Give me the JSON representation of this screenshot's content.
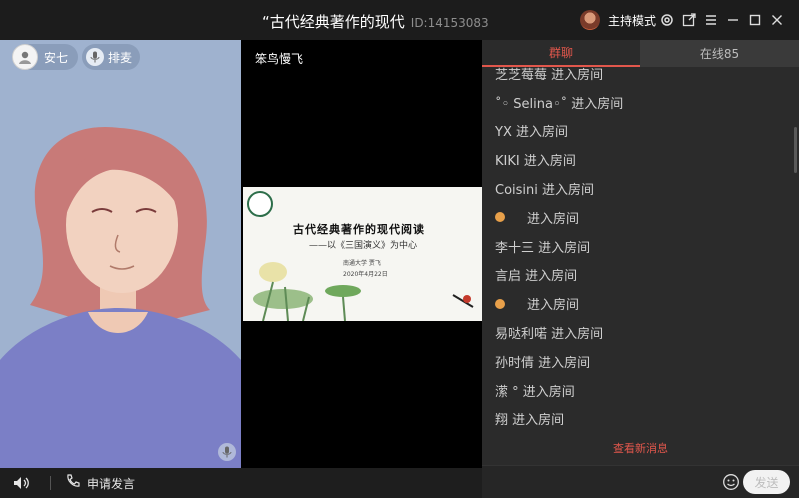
{
  "titlebar": {
    "title": "“古代经典著作的现代",
    "room_id": "ID:14153083",
    "host_mode_label": "主持模式"
  },
  "left_video": {
    "user_name": "安七",
    "mic_queue_label": "排麦"
  },
  "mid_video": {
    "user_name": "笨鸟慢飞",
    "slide": {
      "title": "古代经典著作的现代阅读",
      "subtitle": "——以《三国演义》为中心",
      "author": "南通大学 贾飞",
      "date": "2020年4月22日"
    }
  },
  "bottom_bar": {
    "apply_speak_label": "申请发言"
  },
  "right_panel": {
    "tabs": [
      {
        "label": "群聊"
      },
      {
        "label": "在线85"
      }
    ],
    "messages": [
      {
        "text": "芝芝莓莓 进入房间"
      },
      {
        "text": "˚◦ Selina◦˚ 进入房间"
      },
      {
        "text": "YX 进入房间"
      },
      {
        "text": "KIKI 进入房间"
      },
      {
        "text": "Coisini 进入房间"
      },
      {
        "text": "进入房间",
        "emoji": true
      },
      {
        "text": "李十三 进入房间"
      },
      {
        "text": "言启 进入房间"
      },
      {
        "text": "进入房间",
        "emoji": true
      },
      {
        "text": "易哒利喏 进入房间"
      },
      {
        "text": "孙时倩 进入房间"
      },
      {
        "text": "潆 ° 进入房间"
      },
      {
        "text": "翔 进入房间"
      }
    ],
    "new_messages_label": "查看新消息",
    "input_value": "",
    "send_label": "发送"
  },
  "colors": {
    "accent": "#e2574c",
    "left_video_bg": "#9fb2cf"
  }
}
